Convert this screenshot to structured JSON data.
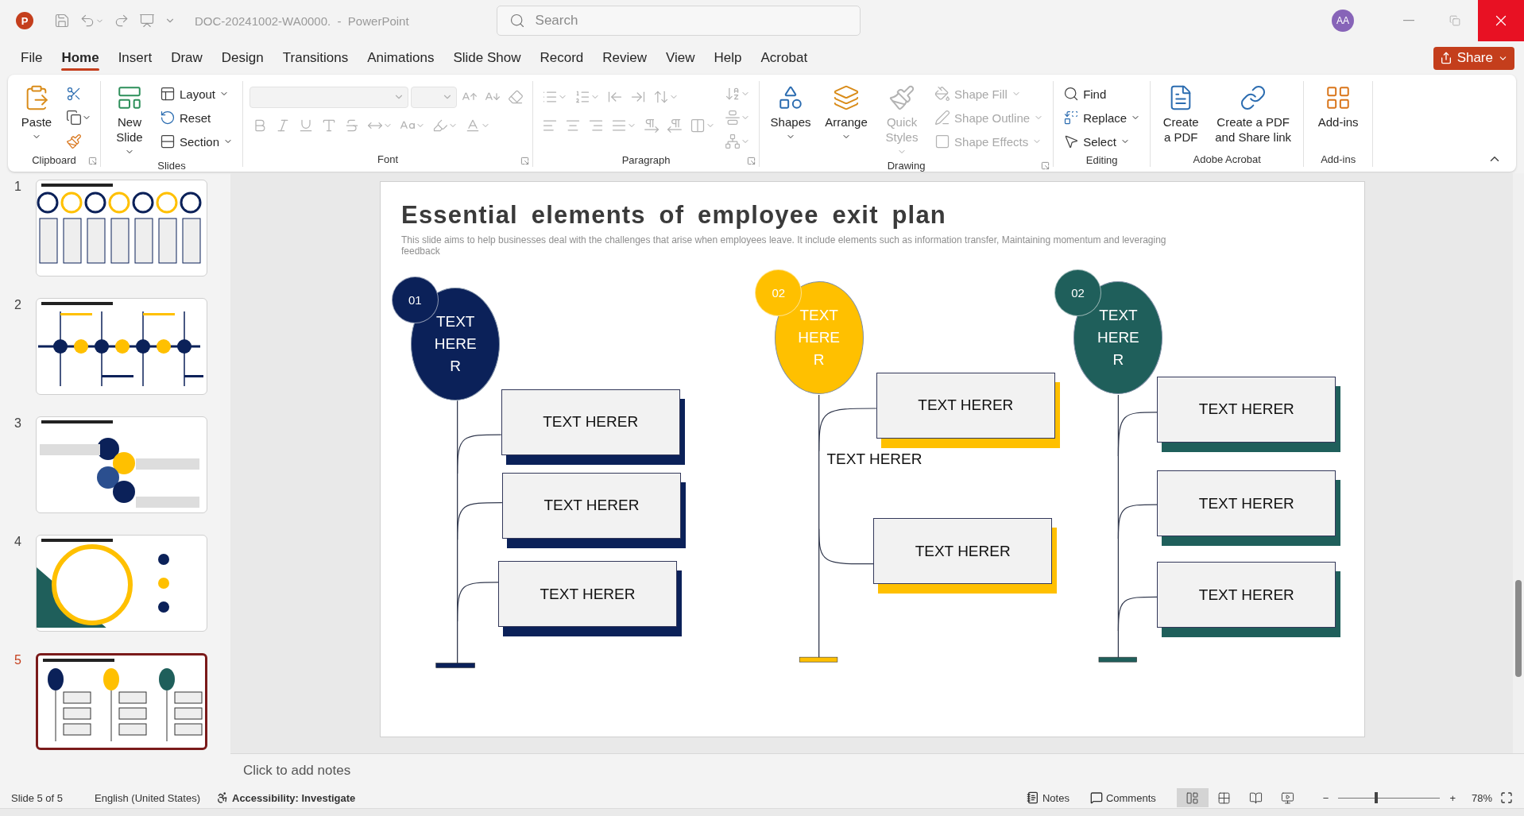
{
  "title_bar": {
    "logo_letter": "P",
    "title": "DOC-20241002-WA0000.  -  PowerPoint",
    "search": {
      "placeholder": "Search"
    },
    "account": {
      "initials": "AA"
    }
  },
  "menu_tabs": [
    {
      "label": "File",
      "selected": false
    },
    {
      "label": "Home",
      "selected": true
    },
    {
      "label": "Insert",
      "selected": false
    },
    {
      "label": "Draw",
      "selected": false
    },
    {
      "label": "Design",
      "selected": false
    },
    {
      "label": "Transitions",
      "selected": false
    },
    {
      "label": "Animations",
      "selected": false
    },
    {
      "label": "Slide Show",
      "selected": false
    },
    {
      "label": "Record",
      "selected": false
    },
    {
      "label": "Review",
      "selected": false
    },
    {
      "label": "View",
      "selected": false
    },
    {
      "label": "Help",
      "selected": false
    },
    {
      "label": "Acrobat",
      "selected": false
    }
  ],
  "share": {
    "label": "Share"
  },
  "ribbon": [
    {
      "label": "Clipboard",
      "launcher": true,
      "items": [
        {
          "kind": "large",
          "label": "Paste",
          "caret": true,
          "disabled": false
        },
        {
          "kind": "icon",
          "caret": false,
          "disabled": false
        },
        {
          "kind": "icon",
          "caret": true,
          "disabled": false
        },
        {
          "kind": "icon",
          "caret": false,
          "disabled": false
        }
      ]
    },
    {
      "label": "Slides",
      "launcher": false,
      "items": [
        {
          "kind": "large",
          "label": "New Slide",
          "caret": true,
          "disabled": false
        },
        {
          "kind": "small",
          "label": "Layout",
          "caret": true,
          "disabled": false
        },
        {
          "kind": "small",
          "label": "Reset",
          "caret": false,
          "disabled": false
        },
        {
          "kind": "small",
          "label": "Section",
          "caret": true,
          "disabled": false
        }
      ]
    },
    {
      "label": "Font",
      "launcher": true,
      "items": [
        {
          "kind": "combo",
          "caret": true,
          "disabled": true
        },
        {
          "kind": "combo",
          "caret": true,
          "disabled": true
        },
        {
          "kind": "icon",
          "caret": false,
          "disabled": true
        },
        {
          "kind": "icon",
          "caret": false,
          "disabled": true
        },
        {
          "kind": "icon",
          "caret": false,
          "disabled": true
        },
        {
          "kind": "icon",
          "caret": false,
          "disabled": true
        },
        {
          "kind": "icon",
          "caret": false,
          "disabled": true
        },
        {
          "kind": "icon",
          "caret": false,
          "disabled": true
        },
        {
          "kind": "icon",
          "caret": false,
          "disabled": true
        },
        {
          "kind": "icon",
          "caret": false,
          "disabled": true
        },
        {
          "kind": "icon",
          "caret": true,
          "disabled": true
        },
        {
          "kind": "icon",
          "caret": true,
          "disabled": true
        },
        {
          "kind": "icon",
          "caret": true,
          "disabled": true
        },
        {
          "kind": "icon",
          "caret": true,
          "disabled": true
        }
      ]
    },
    {
      "label": "Paragraph",
      "launcher": true,
      "items": [
        {
          "kind": "icon",
          "caret": true,
          "disabled": true
        },
        {
          "kind": "icon",
          "caret": true,
          "disabled": true
        },
        {
          "kind": "icon",
          "caret": false,
          "disabled": true
        },
        {
          "kind": "icon",
          "caret": false,
          "disabled": true
        },
        {
          "kind": "icon",
          "caret": true,
          "disabled": true
        },
        {
          "kind": "icon",
          "caret": false,
          "disabled": true
        },
        {
          "kind": "icon",
          "caret": false,
          "disabled": true
        },
        {
          "kind": "icon",
          "caret": false,
          "disabled": true
        },
        {
          "kind": "icon",
          "caret": true,
          "disabled": true
        },
        {
          "kind": "icon",
          "caret": false,
          "disabled": true
        },
        {
          "kind": "icon",
          "caret": false,
          "disabled": true
        },
        {
          "kind": "icon",
          "caret": true,
          "disabled": true
        },
        {
          "kind": "icon",
          "caret": true,
          "disabled": true
        },
        {
          "kind": "icon",
          "caret": true,
          "disabled": true
        },
        {
          "kind": "icon",
          "caret": true,
          "disabled": true
        }
      ]
    },
    {
      "label": "Drawing",
      "launcher": true,
      "items": [
        {
          "kind": "large",
          "label": "Shapes",
          "caret": true,
          "disabled": false
        },
        {
          "kind": "large",
          "label": "Arrange",
          "caret": true,
          "disabled": false
        },
        {
          "kind": "large",
          "label": "Quick Styles",
          "caret": true,
          "disabled": true
        },
        {
          "kind": "small",
          "label": "Shape Fill",
          "caret": true,
          "disabled": true
        },
        {
          "kind": "small",
          "label": "Shape Outline",
          "caret": true,
          "disabled": true
        },
        {
          "kind": "small",
          "label": "Shape Effects",
          "caret": true,
          "disabled": true
        }
      ]
    },
    {
      "label": "Editing",
      "launcher": false,
      "items": [
        {
          "kind": "small",
          "label": "Find",
          "caret": false,
          "disabled": false
        },
        {
          "kind": "small",
          "label": "Replace",
          "caret": true,
          "disabled": false
        },
        {
          "kind": "small",
          "label": "Select",
          "caret": true,
          "disabled": false
        }
      ]
    },
    {
      "label": "Adobe Acrobat",
      "launcher": false,
      "items": [
        {
          "kind": "large",
          "label": "Create a PDF",
          "caret": false,
          "disabled": false
        },
        {
          "kind": "large",
          "label": "Create a PDF and Share link",
          "caret": false,
          "disabled": false
        }
      ]
    },
    {
      "label": "Add-ins",
      "launcher": false,
      "items": [
        {
          "kind": "large",
          "label": "Add-ins",
          "caret": false,
          "disabled": false
        }
      ]
    }
  ],
  "thumbnails": [
    {
      "number": "1",
      "selected": false
    },
    {
      "number": "2",
      "selected": false
    },
    {
      "number": "3",
      "selected": false
    },
    {
      "number": "4",
      "selected": false
    },
    {
      "number": "5",
      "selected": true
    }
  ],
  "slide": {
    "title": "Essential elements of employee exit plan",
    "subtitle": "This slide aims to help businesses deal with the challenges that arise when employees leave. It include elements such as information transfer, Maintaining momentum and leveraging feedback",
    "columns": [
      {
        "badge": "01",
        "color": "#0b2159",
        "balloon_text": "TEXT HERER",
        "boxes": [
          "TEXT HERER",
          "TEXT HERER",
          "TEXT HERER"
        ]
      },
      {
        "badge": "02",
        "color": "#ffc000",
        "balloon_text": "TEXT HERER",
        "label": "TEXT HERER",
        "boxes": [
          "TEXT HERER",
          "TEXT HERER"
        ]
      },
      {
        "badge": "02",
        "color": "#1f5f5b",
        "balloon_text": "TEXT HERER",
        "boxes": [
          "TEXT HERER",
          "TEXT HERER",
          "TEXT HERER"
        ]
      }
    ]
  },
  "notes": {
    "placeholder": "Click to add notes"
  },
  "status_bar": {
    "slide_count": "Slide 5 of 5",
    "language": "English (United States)",
    "accessibility": "Accessibility: Investigate",
    "notes": "Notes",
    "comments": "Comments",
    "views": [
      {
        "selected": true
      },
      {
        "selected": false
      },
      {
        "selected": false
      },
      {
        "selected": false
      }
    ],
    "zoom": {
      "minus": "−",
      "plus": "+",
      "level": 0.37,
      "percent": "78%"
    }
  }
}
